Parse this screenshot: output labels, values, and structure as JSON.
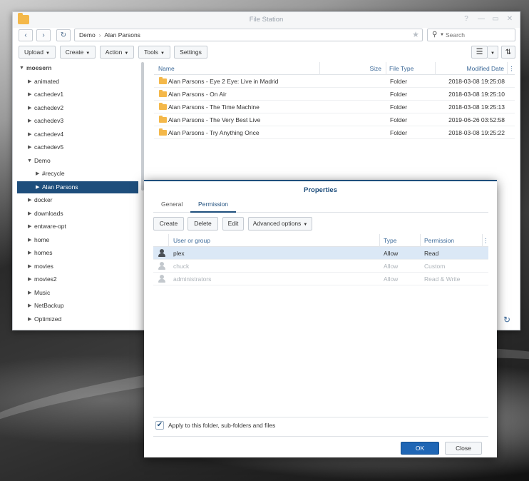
{
  "window": {
    "title": "File Station",
    "controls": [
      "?",
      "—",
      "▭",
      "✕"
    ]
  },
  "path": {
    "segments": [
      "Demo",
      "Alan Parsons"
    ],
    "separator": "›"
  },
  "search": {
    "placeholder": "Search"
  },
  "toolbar": {
    "upload": "Upload",
    "create": "Create",
    "action": "Action",
    "tools": "Tools",
    "settings": "Settings"
  },
  "tree": {
    "root": "moesern",
    "items": [
      "animated",
      "cachedev1",
      "cachedev2",
      "cachedev3",
      "cachedev4",
      "cachedev5",
      "Demo",
      "#recycle",
      "Alan Parsons",
      "docker",
      "downloads",
      "entware-opt",
      "home",
      "homes",
      "movies",
      "movies2",
      "Music",
      "NetBackup",
      "Optimized"
    ]
  },
  "file_list": {
    "columns": [
      "Name",
      "Size",
      "File Type",
      "Modified Date"
    ],
    "rows": [
      {
        "name": "Alan Parsons - Eye 2 Eye: Live in Madrid",
        "size": "",
        "type": "Folder",
        "modified": "2018-03-08 19:25:08"
      },
      {
        "name": "Alan Parsons - On Air",
        "size": "",
        "type": "Folder",
        "modified": "2018-03-08 19:25:10"
      },
      {
        "name": "Alan Parsons - The Time Machine",
        "size": "",
        "type": "Folder",
        "modified": "2018-03-08 19:25:13"
      },
      {
        "name": "Alan Parsons - The Very Best Live",
        "size": "",
        "type": "Folder",
        "modified": "2019-06-26 03:52:58"
      },
      {
        "name": "Alan Parsons - Try Anything Once",
        "size": "",
        "type": "Folder",
        "modified": "2018-03-08 19:25:22"
      }
    ]
  },
  "dialog": {
    "title": "Properties",
    "tabs": [
      "General",
      "Permission"
    ],
    "buttons": {
      "create": "Create",
      "delete": "Delete",
      "edit": "Edit",
      "advanced": "Advanced options"
    },
    "columns": [
      "User or group",
      "Type",
      "Permission"
    ],
    "rows": [
      {
        "user": "plex",
        "type": "Allow",
        "permission": "Read"
      },
      {
        "user": "chuck",
        "type": "Allow",
        "permission": "Custom"
      },
      {
        "user": "administrators",
        "type": "Allow",
        "permission": "Read & Write"
      }
    ],
    "apply_label": "Apply to this folder, sub-folders and files",
    "apply_checked": true,
    "ok": "OK",
    "close": "Close"
  },
  "colors": {
    "accent": "#1e4e7c",
    "primary_button": "#1f66b5",
    "folder": "#f4b84a",
    "header_text": "#3d6a99"
  }
}
